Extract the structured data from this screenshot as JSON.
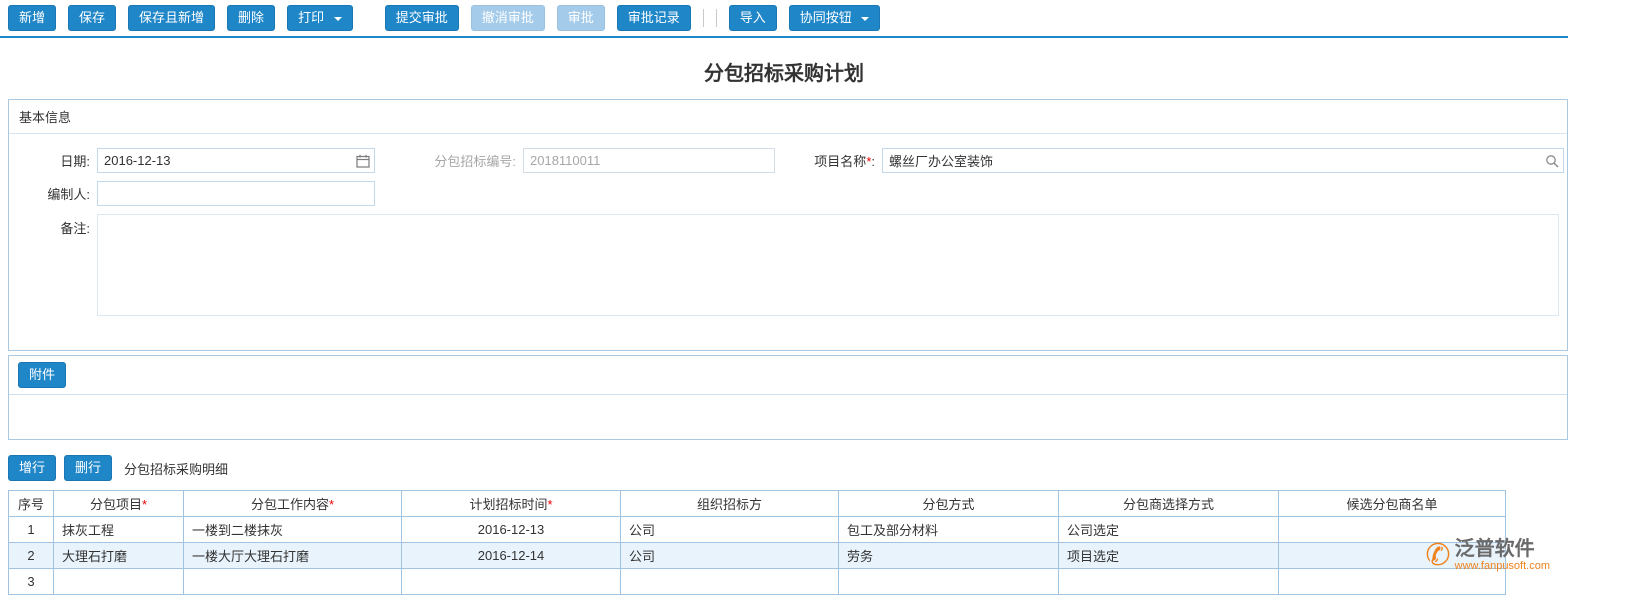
{
  "colors": {
    "primary": "#1f86c8",
    "primary_disabled": "#a4cbe9",
    "panel_border": "#a9c9e2",
    "grid_border": "#9fc3e0",
    "required": "#e60000",
    "logo_orange": "#f0821e"
  },
  "toolbar": {
    "buttons": [
      {
        "label": "新增"
      },
      {
        "label": "保存"
      },
      {
        "label": "保存且新增"
      },
      {
        "label": "删除"
      },
      {
        "label": "打印",
        "dropdown": true
      },
      {
        "label": "提交审批"
      },
      {
        "label": "撤消审批",
        "disabled": true
      },
      {
        "label": "审批",
        "disabled": true
      },
      {
        "label": "审批记录"
      },
      {
        "label": "导入"
      },
      {
        "label": "协同按钮",
        "dropdown": true
      }
    ]
  },
  "page": {
    "title": "分包招标采购计划"
  },
  "basic_info": {
    "section_title": "基本信息",
    "date_label": "日期:",
    "date_value": "2016-12-13",
    "bid_no_label": "分包招标编号:",
    "bid_no_value": "2018110011",
    "project_label": "项目名称",
    "required_mark": "*",
    "colon": ":",
    "project_value": "螺丝厂办公室装饰",
    "compiler_label": "编制人:",
    "compiler_value": "",
    "remark_label": "备注:",
    "remark_value": ""
  },
  "attachment": {
    "button_label": "附件"
  },
  "detail": {
    "add_row_label": "增行",
    "delete_row_label": "删行",
    "section_title": "分包招标采购明细",
    "table": {
      "headers": [
        {
          "label": "序号",
          "star": ""
        },
        {
          "label": "分包项目",
          "star": "*"
        },
        {
          "label": "分包工作内容",
          "star": "*"
        },
        {
          "label": "计划招标时间",
          "star": "*"
        },
        {
          "label": "组织招标方",
          "star": ""
        },
        {
          "label": "分包方式",
          "star": ""
        },
        {
          "label": "分包商选择方式",
          "star": ""
        },
        {
          "label": "候选分包商名单",
          "star": ""
        }
      ],
      "rows": [
        {
          "cells": [
            "1",
            "抹灰工程",
            "一楼到二楼抹灰",
            "2016-12-13",
            "公司",
            "包工及部分材料",
            "公司选定",
            ""
          ]
        },
        {
          "cells": [
            "2",
            "大理石打磨",
            "一楼大厅大理石打磨",
            "2016-12-14",
            "公司",
            "劳务",
            "项目选定",
            ""
          ]
        },
        {
          "cells": [
            "3",
            "",
            "",
            "",
            "",
            "",
            "",
            ""
          ]
        }
      ]
    }
  },
  "footer": {
    "brand": "泛普软件",
    "url": "www.fanpusoft.com"
  }
}
